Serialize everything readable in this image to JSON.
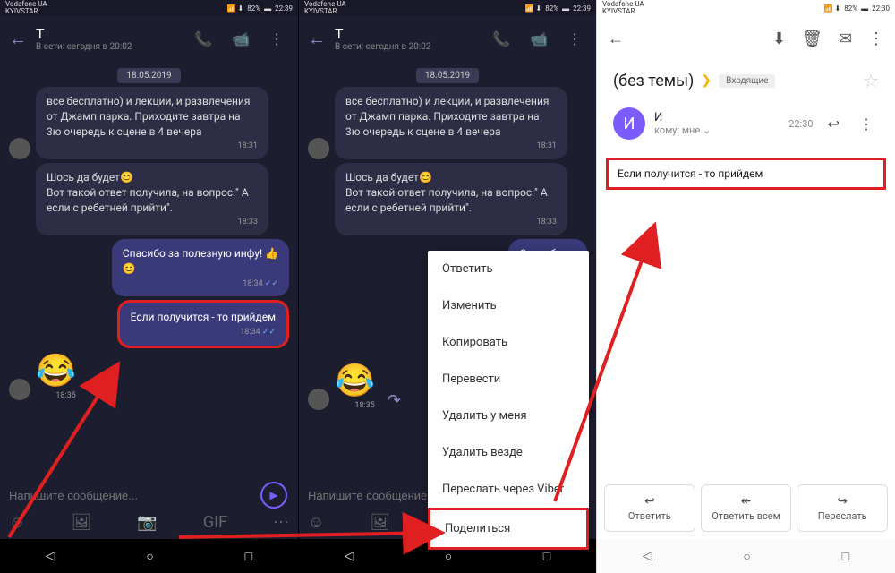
{
  "status": {
    "carrier_line1": "Vodafone UA",
    "carrier_line2": "KYIVSTAR",
    "battery": "82%",
    "time_chat": "22:39",
    "time_gmail": "22:30",
    "signal": "📶"
  },
  "chat": {
    "title": "Т",
    "subtitle": "В сети: сегодня в 20:02",
    "date": "18.05.2019",
    "msg1": "все бесплатно) и лекции, и развлечения от Джамп парка. Приходите завтра на 3ю очередь к сцене в 4 вечера",
    "msg1_time": "18:31",
    "msg2_line1": "Шось да будет",
    "msg2_line2": "Вот такой ответ получила, на вопрос:\" А если с ребетней прийти\".",
    "msg2_time": "18:33",
    "msg3": "Спасибо за полезную инфу!",
    "msg3_short": "Спасибо за",
    "msg3_time": "18:34",
    "msg4": "Если получится - то прийдем",
    "msg4_time": "18:34",
    "msg5_time": "18:35",
    "composer_placeholder": "Напишите сообщение..."
  },
  "menu": {
    "reply": "Ответить",
    "edit": "Изменить",
    "copy": "Копировать",
    "translate": "Перевести",
    "delete_mine": "Удалить у меня",
    "delete_all": "Удалить везде",
    "forward_viber": "Переслать через Viber",
    "share": "Поделиться"
  },
  "gmail": {
    "subject": "(без темы)",
    "inbox": "Входящие",
    "sender_initial": "И",
    "sender_name": "И",
    "to_label": "кому: мне",
    "time": "22:30",
    "body": "Если получится - то прийдем",
    "action_reply": "Ответить",
    "action_reply_all": "Ответить всем",
    "action_forward": "Переслать"
  }
}
